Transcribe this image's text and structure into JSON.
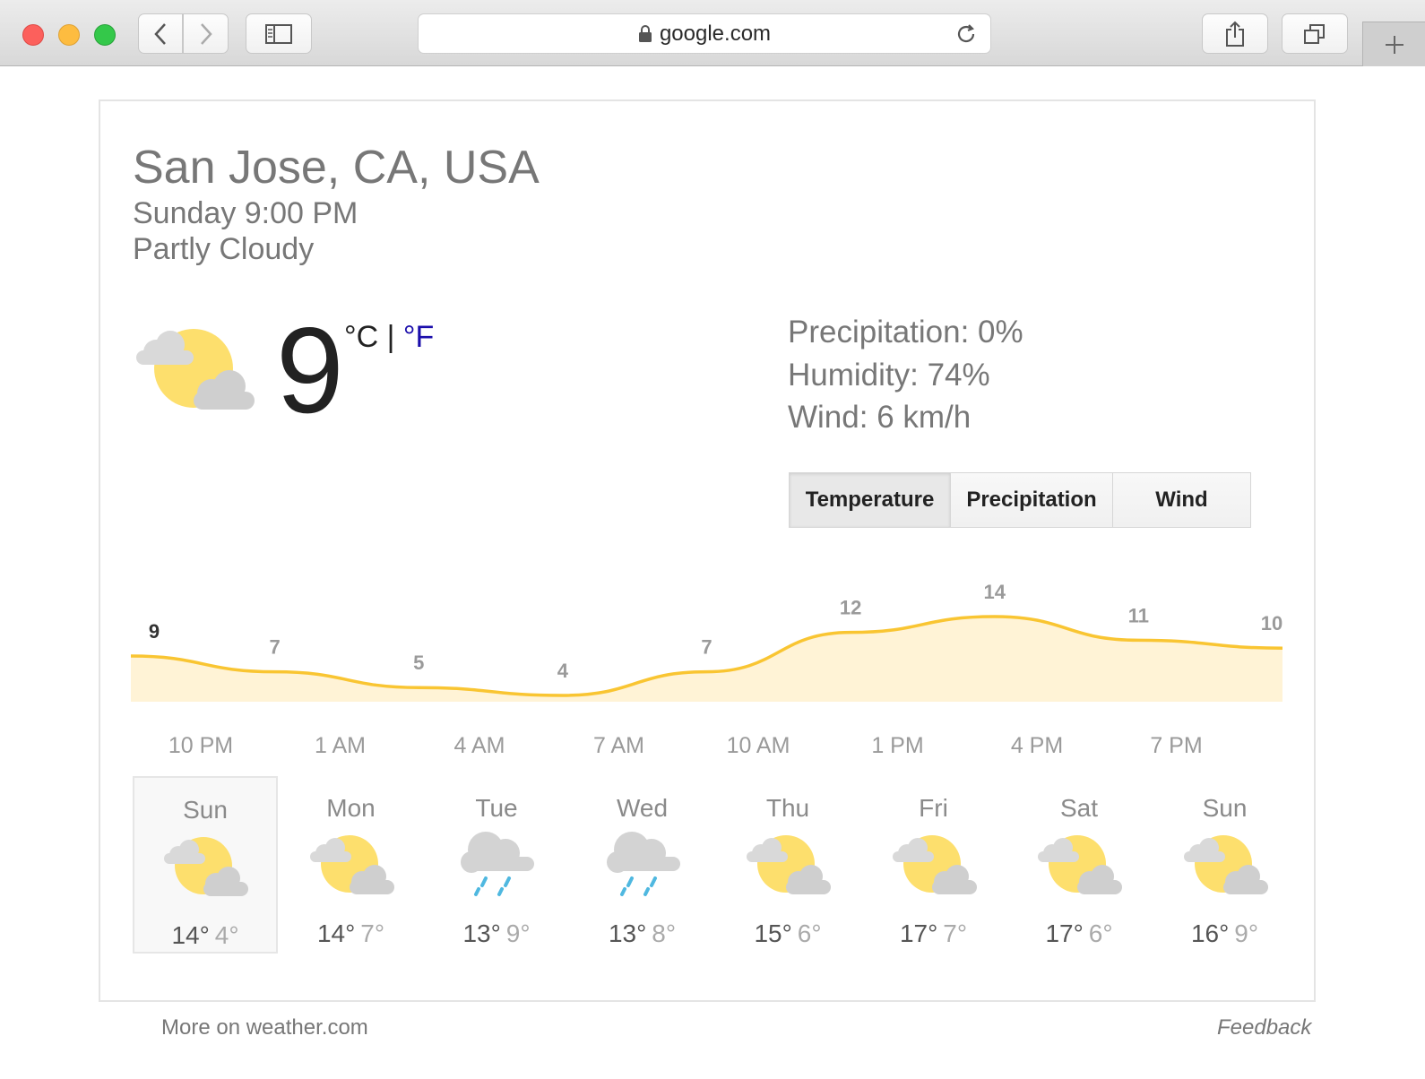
{
  "browser": {
    "url": "google.com",
    "icons": [
      "back-icon",
      "forward-icon",
      "sidebar-icon",
      "lock-icon",
      "reload-icon",
      "share-icon",
      "tabs-icon",
      "plus-icon"
    ]
  },
  "weather": {
    "location": "San Jose, CA, USA",
    "datetime": "Sunday 9:00 PM",
    "condition": "Partly Cloudy",
    "temperature": "9",
    "unit_c": "°C",
    "unit_sep": " | ",
    "unit_f": "°F",
    "precipitation": "Precipitation: 0%",
    "humidity": "Humidity: 74%",
    "wind": "Wind: 6 km/h",
    "tabs": [
      "Temperature",
      "Precipitation",
      "Wind"
    ],
    "active_tab": "Temperature",
    "forecast": [
      {
        "day": "Sun",
        "hi": "14°",
        "lo": "4°",
        "icon": "partly-cloudy-icon",
        "selected": true
      },
      {
        "day": "Mon",
        "hi": "14°",
        "lo": "7°",
        "icon": "partly-cloudy-icon",
        "selected": false
      },
      {
        "day": "Tue",
        "hi": "13°",
        "lo": "9°",
        "icon": "rain-icon",
        "selected": false
      },
      {
        "day": "Wed",
        "hi": "13°",
        "lo": "8°",
        "icon": "rain-icon",
        "selected": false
      },
      {
        "day": "Thu",
        "hi": "15°",
        "lo": "6°",
        "icon": "partly-cloudy-icon",
        "selected": false
      },
      {
        "day": "Fri",
        "hi": "17°",
        "lo": "7°",
        "icon": "partly-cloudy-icon",
        "selected": false
      },
      {
        "day": "Sat",
        "hi": "17°",
        "lo": "6°",
        "icon": "partly-cloudy-icon",
        "selected": false
      },
      {
        "day": "Sun",
        "hi": "16°",
        "lo": "9°",
        "icon": "partly-cloudy-icon",
        "selected": false
      }
    ],
    "more_link": "More on weather.com",
    "feedback": "Feedback"
  },
  "chart_data": {
    "type": "area",
    "categories": [
      "10 PM",
      "1 AM",
      "4 AM",
      "7 AM",
      "10 AM",
      "1 PM",
      "4 PM",
      "7 PM"
    ],
    "values": [
      9,
      7,
      5,
      4,
      7,
      12,
      14,
      11,
      10
    ],
    "series_color": "#f9c532",
    "fill_color": "#fff3d6",
    "first_label_color": "#333333",
    "label_color": "#9a9a9a"
  }
}
